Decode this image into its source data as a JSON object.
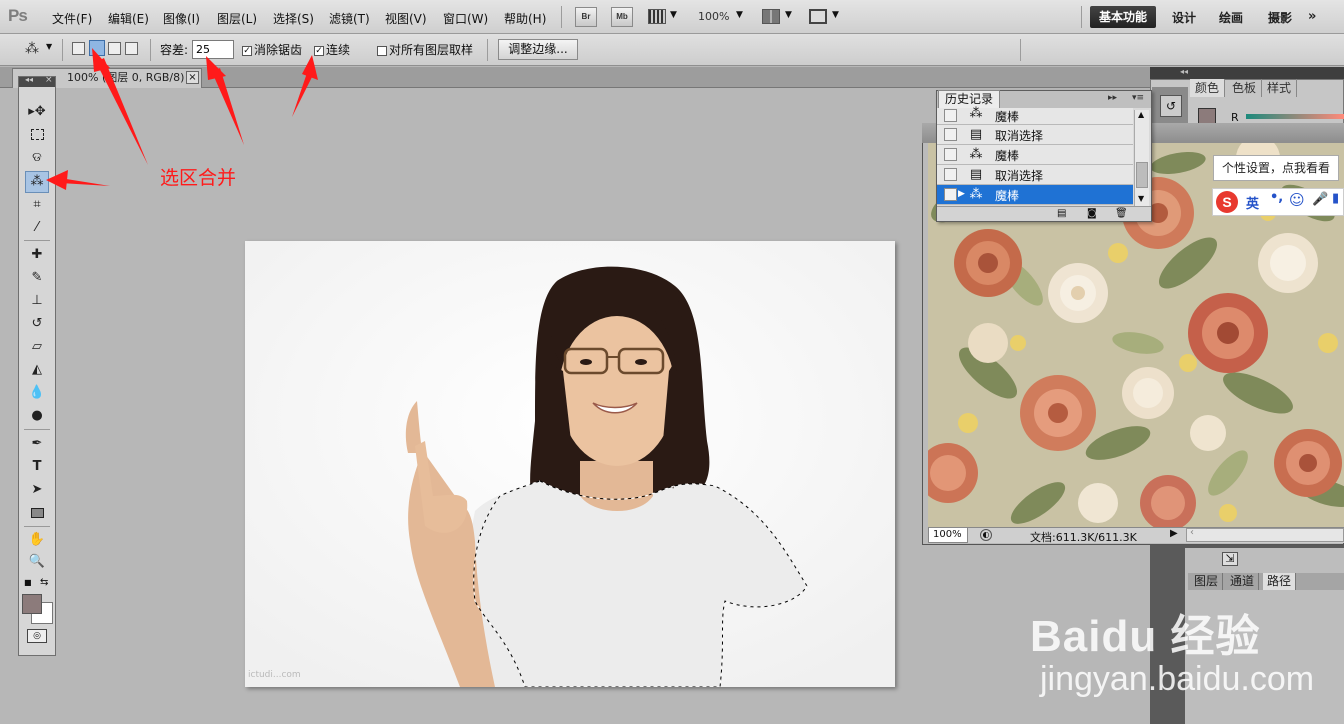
{
  "app": {
    "logo": "Ps"
  },
  "menu": [
    "文件(F)",
    "编辑(E)",
    "图像(I)",
    "图层(L)",
    "选择(S)",
    "滤镜(T)",
    "视图(V)",
    "窗口(W)",
    "帮助(H)"
  ],
  "menu_buttons": {
    "bridge": "Br",
    "mini_bridge": "Mb"
  },
  "zoom": "100%",
  "workspaces": {
    "active": "基本功能",
    "items": [
      "设计",
      "绘画",
      "摄影"
    ]
  },
  "options": {
    "tolerance_label": "容差:",
    "tolerance_value": "25",
    "antialias_label": "消除锯齿",
    "antialias_checked": true,
    "contiguous_label": "连续",
    "contiguous_checked": true,
    "sample_all_label": "对所有图层取样",
    "sample_all_checked": false,
    "refine_edge": "调整边缘...",
    "selection_mode_active": "add-to-selection"
  },
  "document_tab": {
    "title": "100% (图层 0, RGB/8)"
  },
  "history": {
    "title": "历史记录",
    "items": [
      {
        "label": "魔棒",
        "icon": "magic-wand-icon",
        "selected": false
      },
      {
        "label": "取消选择",
        "icon": "document-icon",
        "selected": false
      },
      {
        "label": "魔棒",
        "icon": "magic-wand-icon",
        "selected": false
      },
      {
        "label": "取消选择",
        "icon": "document-icon",
        "selected": false
      },
      {
        "label": "魔棒",
        "icon": "magic-wand-icon",
        "selected": true
      }
    ]
  },
  "image_window": {
    "zoom": "100%",
    "doc_size": "文档:611.3K/611.3K"
  },
  "color_panel": {
    "tabs": [
      "颜色",
      "色板",
      "样式"
    ],
    "channel_label": "R"
  },
  "layers_panel": {
    "tabs": [
      "图层",
      "通道",
      "路径"
    ],
    "active": "路径"
  },
  "ime": {
    "tooltip": "个性设置，点我看看",
    "lang": "英",
    "logo": "S"
  },
  "annotation": {
    "label": "选区合并",
    "color": "#ff1a1a"
  },
  "watermark": {
    "brand": "Baidu 经验",
    "url": "jingyan.baidu.com"
  },
  "colors": {
    "accent": "#1f72d4",
    "foreground_swatch": "#8c7b7b",
    "background_swatch": "#ffffff"
  }
}
